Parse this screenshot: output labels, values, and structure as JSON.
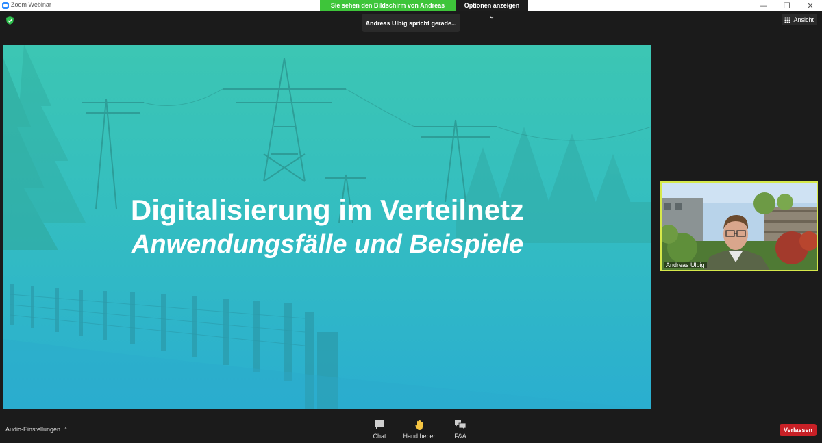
{
  "window": {
    "title": "Zoom Webinar",
    "minimize_glyph": "—",
    "restore_glyph": "❐",
    "close_glyph": "✕"
  },
  "share_banner": {
    "text": "Sie sehen den Bildschirm von Andreas Ulbig",
    "options_label": "Optionen anzeigen ⌄",
    "color": "#3ec53a"
  },
  "speaking_indicator": "Andreas Ulbig spricht gerade...",
  "view_button": {
    "label": "Ansicht",
    "icon": "grid-icon"
  },
  "slide": {
    "headline": "Digitalisierung im Verteilnetz",
    "subline": "Anwendungsfälle und Beispiele",
    "accent": "#3cc6b3"
  },
  "video": {
    "participant_name": "Andreas Ulbig",
    "border_color": "#d6e84a"
  },
  "toolbar": {
    "audio_label": "Audio-Einstellungen",
    "caret": "^",
    "chat_label": "Chat",
    "raise_hand_label": "Hand heben",
    "qa_label": "F&A",
    "leave_label": "Verlassen",
    "leave_color": "#c82026"
  }
}
